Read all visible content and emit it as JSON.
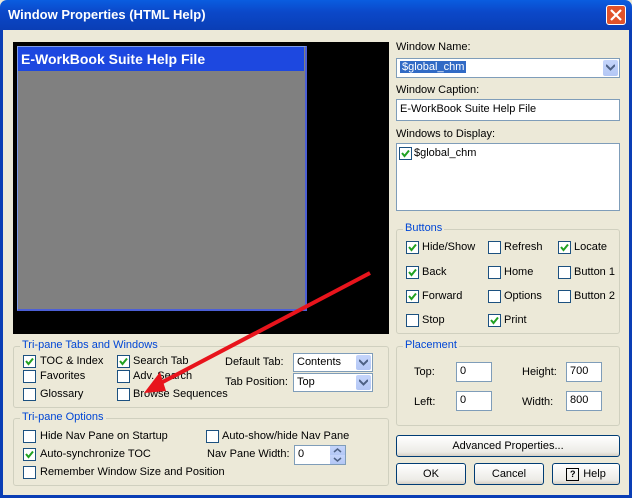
{
  "window": {
    "title": "Window Properties (HTML Help)"
  },
  "preview": {
    "caption": "E-WorkBook Suite Help File"
  },
  "window_name": {
    "label": "Window Name:",
    "value": "$global_chm"
  },
  "window_caption": {
    "label": "Window Caption:",
    "value": "E-WorkBook Suite Help File"
  },
  "windows_to_display": {
    "label": "Windows to Display:",
    "items": [
      {
        "label": "$global_chm",
        "checked": true
      }
    ]
  },
  "buttons_group": {
    "title": "Buttons",
    "items": [
      {
        "label": "Hide/Show",
        "checked": true
      },
      {
        "label": "Refresh",
        "checked": false
      },
      {
        "label": "Locate",
        "checked": true
      },
      {
        "label": "Back",
        "checked": true
      },
      {
        "label": "Home",
        "checked": false
      },
      {
        "label": "Button 1",
        "checked": false
      },
      {
        "label": "Forward",
        "checked": true
      },
      {
        "label": "Options",
        "checked": false
      },
      {
        "label": "Button 2",
        "checked": false
      },
      {
        "label": "Stop",
        "checked": false
      },
      {
        "label": "Print",
        "checked": true
      }
    ]
  },
  "tabs_group": {
    "title": "Tri-pane Tabs and Windows",
    "toc_index": {
      "label": "TOC & Index",
      "checked": true
    },
    "search_tab": {
      "label": "Search Tab",
      "checked": true
    },
    "favorites": {
      "label": "Favorites",
      "checked": false
    },
    "adv_search": {
      "label": "Adv. Search",
      "checked": false
    },
    "glossary": {
      "label": "Glossary",
      "checked": false
    },
    "browse_sequences": {
      "label": "Browse Sequences",
      "checked": false
    },
    "default_tab": {
      "label": "Default Tab:",
      "value": "Contents"
    },
    "tab_position": {
      "label": "Tab Position:",
      "value": "Top"
    }
  },
  "options_group": {
    "title": "Tri-pane Options",
    "hide_nav": {
      "label": "Hide Nav Pane on Startup",
      "checked": false
    },
    "auto_show_hide": {
      "label": "Auto-show/hide Nav Pane",
      "checked": false
    },
    "auto_sync": {
      "label": "Auto-synchronize TOC",
      "checked": true
    },
    "nav_width": {
      "label": "Nav Pane Width:",
      "value": "0"
    },
    "remember_size": {
      "label": "Remember Window Size and Position",
      "checked": false
    }
  },
  "placement": {
    "title": "Placement",
    "top": {
      "label": "Top:",
      "value": "0"
    },
    "height": {
      "label": "Height:",
      "value": "700"
    },
    "left": {
      "label": "Left:",
      "value": "0"
    },
    "width": {
      "label": "Width:",
      "value": "800"
    }
  },
  "actions": {
    "advanced": "Advanced Properties...",
    "ok": "OK",
    "cancel": "Cancel",
    "help": "Help"
  },
  "colors": {
    "title_bar": "#0b48c9",
    "group_title": "#0046d5",
    "annotation_arrow": "#e8141c",
    "caption_bar": "#1d48e0"
  }
}
